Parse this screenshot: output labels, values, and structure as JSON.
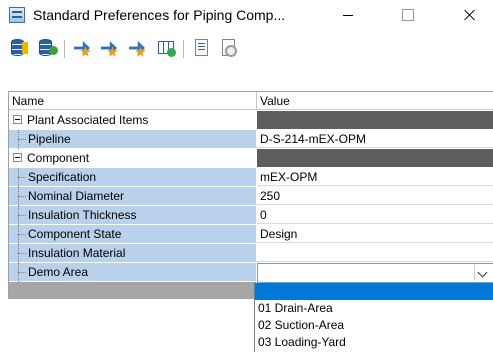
{
  "window": {
    "title": "Standard Preferences for Piping Comp..."
  },
  "toolbar": {
    "buttons": [
      {
        "icon": "database-flag-icon"
      },
      {
        "icon": "database-check-icon"
      },
      {
        "icon": "arrow-star-icon"
      },
      {
        "icon": "arrow-star-icon-2"
      },
      {
        "icon": "arrow-star-icon-3"
      },
      {
        "icon": "grid-check-icon"
      },
      {
        "icon": "page-import-icon"
      },
      {
        "icon": "page-clock-icon"
      }
    ]
  },
  "grid": {
    "header": {
      "name": "Name",
      "value": "Value"
    },
    "rows": [
      {
        "kind": "category",
        "name": "Plant Associated Items",
        "value": ""
      },
      {
        "kind": "property",
        "name": "Pipeline",
        "value": "D-S-214-mEX-OPM"
      },
      {
        "kind": "category",
        "name": "Component",
        "value": ""
      },
      {
        "kind": "property",
        "name": "Specification",
        "value": "mEX-OPM"
      },
      {
        "kind": "property",
        "name": "Nominal Diameter",
        "value": "250"
      },
      {
        "kind": "property",
        "name": "Insulation Thickness",
        "value": "0"
      },
      {
        "kind": "property",
        "name": "Component State",
        "value": "Design"
      },
      {
        "kind": "property",
        "name": "Insulation Material",
        "value": ""
      },
      {
        "kind": "property",
        "name": "Demo Area",
        "value": ""
      }
    ]
  },
  "dropdown": {
    "options": [
      "",
      "01 Drain-Area",
      "02 Suction-Area",
      "03 Loading-Yard"
    ],
    "selected_index": 0
  },
  "colors": {
    "property_name_bg": "#b9d1ea",
    "category_value_bg": "#5e5e5e",
    "selection": "#0078d7"
  }
}
